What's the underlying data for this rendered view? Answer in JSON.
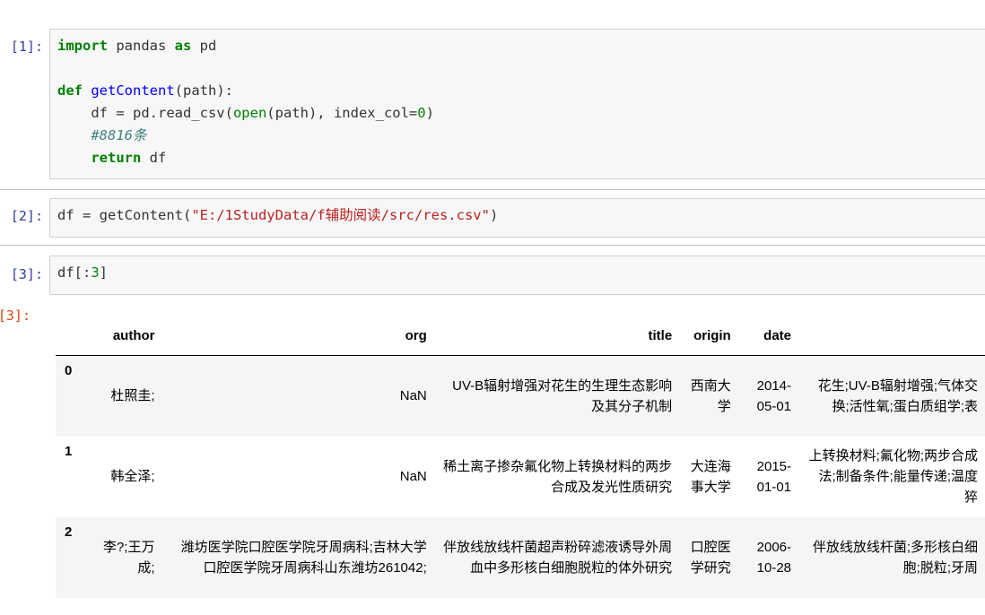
{
  "cells": [
    {
      "prompt": "[1]:",
      "lines": {
        "l1_kw1": "import",
        "l1_txt": " pandas ",
        "l1_kw2": "as",
        "l1_txt2": " pd",
        "l3_kw": "def",
        "l3_fn": "getContent",
        "l3_txt": "(path):",
        "l4_a": "    df = pd.read_csv(",
        "l4_bi": "open",
        "l4_b": "(path), index_col=",
        "l4_num": "0",
        "l4_c": ")",
        "l5_cm": "    #8816条",
        "l6_ind": "    ",
        "l6_kw": "return",
        "l6_txt": " df"
      }
    },
    {
      "prompt": "[2]:",
      "lines": {
        "a": "df = getContent(",
        "str": "\"E:/1StudyData/f辅助阅读/src/res.csv\"",
        "b": ")"
      }
    },
    {
      "prompt": "[3]:",
      "lines": {
        "a": "df[:",
        "num": "3",
        "b": "]"
      }
    }
  ],
  "output_prompt": "[3]:",
  "table": {
    "columns": [
      "author",
      "org",
      "title",
      "origin",
      "date",
      ""
    ],
    "rows": [
      {
        "index": "0",
        "author": "杜照圭;",
        "org": "NaN",
        "title": "UV-B辐射增强对花生的生理生态影响及其分子机制",
        "origin": "西南大学",
        "date": "2014-05-01",
        "keywords": "花生;UV-B辐射增强;气体交换;活性氧;蛋白质组学;表"
      },
      {
        "index": "1",
        "author": "韩全泽;",
        "org": "NaN",
        "title": "稀土离子掺杂氟化物上转换材料的两步合成及发光性质研究",
        "origin": "大连海事大学",
        "date": "2015-01-01",
        "keywords": "上转换材料;氟化物;两步合成法;制备条件;能量传递;温度猝"
      },
      {
        "index": "2",
        "author": "李?;王万成;",
        "org": "潍坊医学院口腔医学院牙周病科;吉林大学口腔医学院牙周病科山东潍坊261042;",
        "title": "伴放线放线杆菌超声粉碎滤液诱导外周血中多形核白细胞脱粒的体外研究",
        "origin": "口腔医学研究",
        "date": "2006-10-28",
        "keywords": "伴放线放线杆菌;多形核白细胞;脱粒;牙周"
      }
    ]
  },
  "colors": {
    "prompt_in": "#303F9F",
    "prompt_out": "#D84315",
    "keyword": "#008000",
    "string": "#BA2121"
  }
}
